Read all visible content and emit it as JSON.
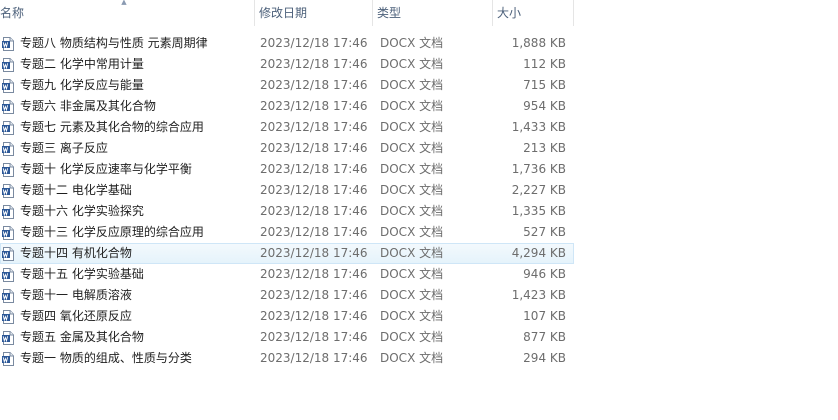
{
  "columns": {
    "name": "名称",
    "date": "修改日期",
    "type": "类型",
    "size": "大小"
  },
  "sort_indicator": "^",
  "file_icon": "word-document-icon",
  "hover_row_index": 10,
  "files": [
    {
      "name": "专题八 物质结构与性质 元素周期律",
      "date": "2023/12/18 17:46",
      "type": "DOCX 文档",
      "size": "1,888 KB"
    },
    {
      "name": "专题二 化学中常用计量",
      "date": "2023/12/18 17:46",
      "type": "DOCX 文档",
      "size": "112 KB"
    },
    {
      "name": "专题九 化学反应与能量",
      "date": "2023/12/18 17:46",
      "type": "DOCX 文档",
      "size": "715 KB"
    },
    {
      "name": "专题六 非金属及其化合物",
      "date": "2023/12/18 17:46",
      "type": "DOCX 文档",
      "size": "954 KB"
    },
    {
      "name": "专题七 元素及其化合物的综合应用",
      "date": "2023/12/18 17:46",
      "type": "DOCX 文档",
      "size": "1,433 KB"
    },
    {
      "name": "专题三 离子反应",
      "date": "2023/12/18 17:46",
      "type": "DOCX 文档",
      "size": "213 KB"
    },
    {
      "name": "专题十 化学反应速率与化学平衡",
      "date": "2023/12/18 17:46",
      "type": "DOCX 文档",
      "size": "1,736 KB"
    },
    {
      "name": "专题十二 电化学基础",
      "date": "2023/12/18 17:46",
      "type": "DOCX 文档",
      "size": "2,227 KB"
    },
    {
      "name": "专题十六 化学实验探究",
      "date": "2023/12/18 17:46",
      "type": "DOCX 文档",
      "size": "1,335 KB"
    },
    {
      "name": "专题十三 化学反应原理的综合应用",
      "date": "2023/12/18 17:46",
      "type": "DOCX 文档",
      "size": "527 KB"
    },
    {
      "name": "专题十四 有机化合物",
      "date": "2023/12/18 17:46",
      "type": "DOCX 文档",
      "size": "4,294 KB"
    },
    {
      "name": "专题十五 化学实验基础",
      "date": "2023/12/18 17:46",
      "type": "DOCX 文档",
      "size": "946 KB"
    },
    {
      "name": "专题十一 电解质溶液",
      "date": "2023/12/18 17:46",
      "type": "DOCX 文档",
      "size": "1,423 KB"
    },
    {
      "name": "专题四 氧化还原反应",
      "date": "2023/12/18 17:46",
      "type": "DOCX 文档",
      "size": "107 KB"
    },
    {
      "name": "专题五 金属及其化合物",
      "date": "2023/12/18 17:46",
      "type": "DOCX 文档",
      "size": "877 KB"
    },
    {
      "name": "专题一 物质的组成、性质与分类",
      "date": "2023/12/18 17:46",
      "type": "DOCX 文档",
      "size": "294 KB"
    }
  ]
}
